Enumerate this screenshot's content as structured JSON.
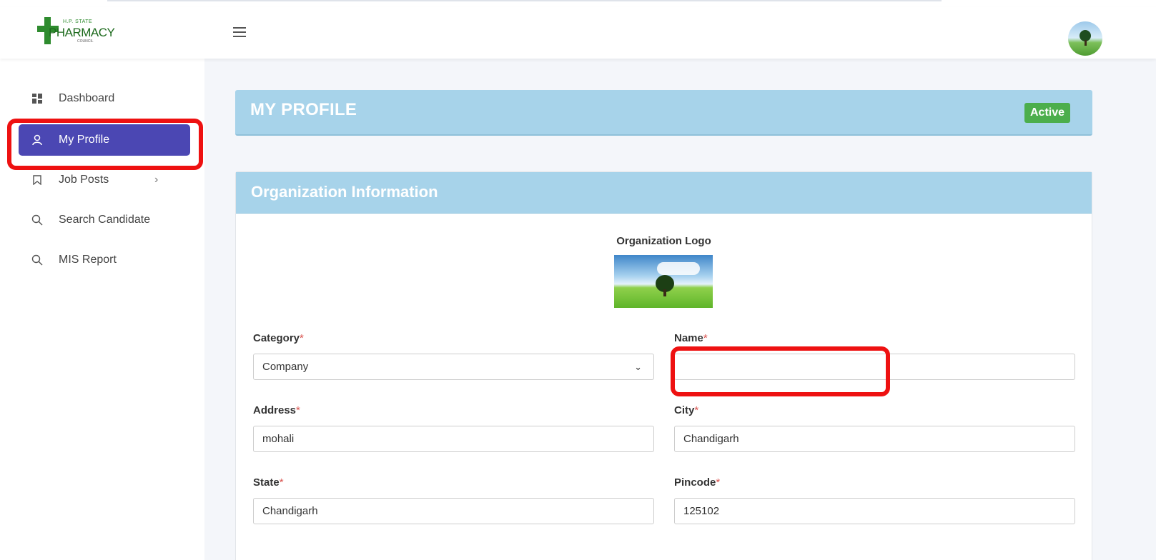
{
  "brand": {
    "logo_top": "H.P. STATE",
    "logo_main": "PHARMACY",
    "logo_sub": "COUNCIL"
  },
  "sidebar": {
    "items": [
      {
        "label": "Dashboard",
        "icon": "dashboard-icon"
      },
      {
        "label": "My Profile",
        "icon": "user-icon",
        "active": true
      },
      {
        "label": "Job Posts",
        "icon": "bookmark-icon",
        "has_submenu": true
      },
      {
        "label": "Search Candidate",
        "icon": "search-icon"
      },
      {
        "label": "MIS Report",
        "icon": "search-icon"
      }
    ]
  },
  "profile": {
    "title": "MY PROFILE",
    "status": "Active"
  },
  "org": {
    "title": "Organization Information",
    "logo_label": "Organization Logo",
    "fields": {
      "category": {
        "label": "Category",
        "value": "Company"
      },
      "name": {
        "label": "Name",
        "value": ""
      },
      "address": {
        "label": "Address",
        "value": "mohali"
      },
      "city": {
        "label": "City",
        "value": "Chandigarh"
      },
      "state": {
        "label": "State",
        "value": "Chandigarh"
      },
      "pincode": {
        "label": "Pincode",
        "value": "125102"
      }
    },
    "required_mark": "*"
  },
  "colors": {
    "accent": "#4b47b3",
    "header_bg": "#a7d3ea",
    "status_green": "#4cae4c",
    "annotation_red": "#ee1111"
  }
}
